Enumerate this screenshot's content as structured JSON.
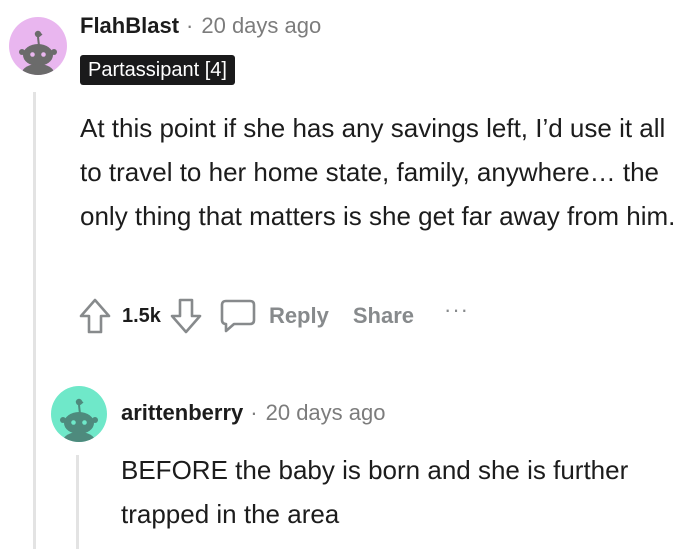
{
  "comment": {
    "username": "FlahBlast",
    "separator": "·",
    "timestamp": "20 days ago",
    "flair": "Partassipant [4]",
    "body": "At this point if she has any savings left, I’d use it all to travel to her home state, family, anywhere… the only thing that matters is she get far away from him.",
    "avatar_color": "#e9b6ef",
    "actions": {
      "upvote_count": "1.5k",
      "reply_label": "Reply",
      "share_label": "Share",
      "more_label": "···"
    },
    "icons": [
      "upvote-arrow-icon",
      "downvote-arrow-icon",
      "comment-bubble-icon",
      "more-dots-icon"
    ]
  },
  "reply": {
    "username": "arittenberry",
    "separator": "·",
    "timestamp": "20 days ago",
    "body": "BEFORE the baby is born and she is further trapped in the area",
    "avatar_color": "#6fe8c9"
  }
}
